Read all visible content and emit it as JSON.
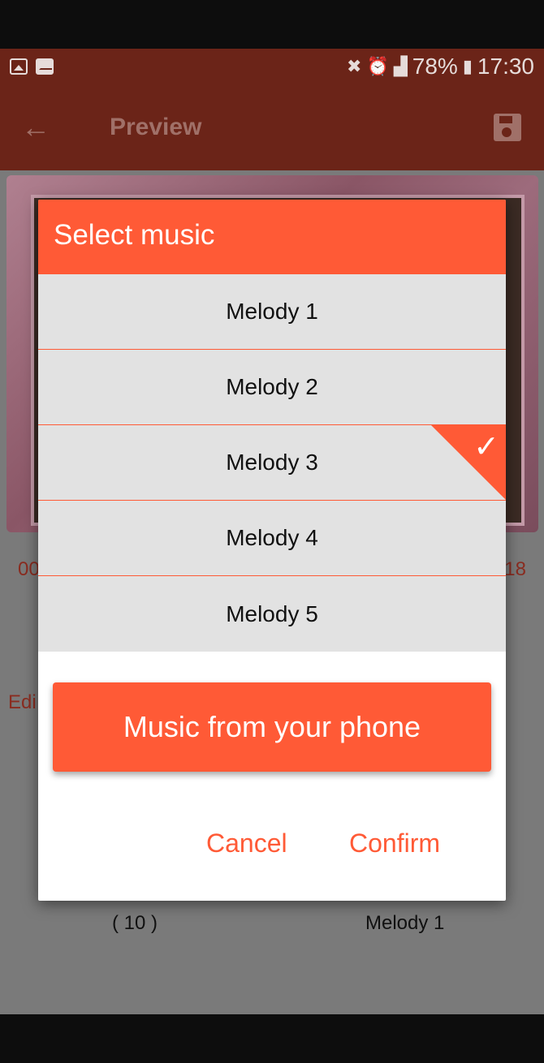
{
  "status_bar": {
    "left_icons": [
      "image-icon",
      "mail-icon"
    ],
    "right_icons": [
      "vibrate-mute-icon",
      "alarm-icon",
      "signal-icon"
    ],
    "battery": "78%",
    "battery_icon": "battery-charging-icon",
    "time": "17:30"
  },
  "app_bar": {
    "back_icon": "arrow-left-icon",
    "title": "Preview",
    "save_icon": "save-icon"
  },
  "background": {
    "time_left": "00",
    "time_right": "18",
    "edit_label": "Edi",
    "count_label": "( 10 )",
    "melody_label": "Melody 1"
  },
  "dialog": {
    "title": "Select music",
    "items": [
      {
        "label": "Melody 1",
        "selected": false
      },
      {
        "label": "Melody 2",
        "selected": false
      },
      {
        "label": "Melody 3",
        "selected": true
      },
      {
        "label": "Melody 4",
        "selected": false
      },
      {
        "label": "Melody 5",
        "selected": false
      }
    ],
    "phone_button": "Music from your phone",
    "cancel": "Cancel",
    "confirm": "Confirm",
    "check_icon": "checkmark-icon"
  },
  "colors": {
    "accent": "#ff5a36",
    "app_bar": "#6b2418",
    "list_bg": "#e2e2e2"
  }
}
